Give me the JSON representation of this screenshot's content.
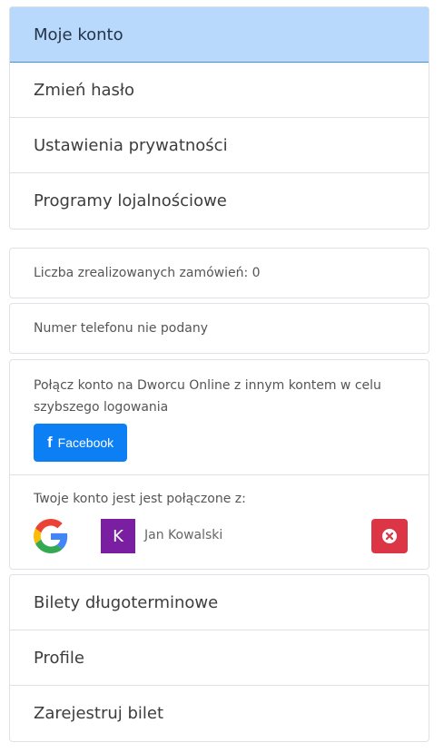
{
  "menu_top": {
    "items": [
      {
        "label": "Moje konto",
        "active": true
      },
      {
        "label": "Zmień hasło",
        "active": false
      },
      {
        "label": "Ustawienia prywatności",
        "active": false
      },
      {
        "label": "Programy lojalnościowe",
        "active": false
      }
    ]
  },
  "orders": {
    "text": "Liczba zrealizowanych zamówień: 0"
  },
  "phone": {
    "text": "Numer telefonu nie podany"
  },
  "connect": {
    "text": "Połącz konto na Dworcu Online z innym kontem w celu szybszego logowania",
    "facebook_icon": "f",
    "facebook_label": "Facebook"
  },
  "linked": {
    "title": "Twoje konto jest jest połączone z:",
    "provider_icon": "google-icon",
    "avatar_letter": "K",
    "user_name": "Jan Kowalski",
    "remove_icon": "close-circle-icon"
  },
  "menu_bottom": {
    "items": [
      {
        "label": "Bilety długoterminowe"
      },
      {
        "label": "Profile"
      },
      {
        "label": "Zarejestruj bilet"
      }
    ]
  },
  "colors": {
    "active_bg": "#b8d9fc",
    "active_border": "#3f8fe0",
    "facebook": "#0d7ff5",
    "avatar": "#7b1fa2",
    "danger": "#dc3545"
  }
}
